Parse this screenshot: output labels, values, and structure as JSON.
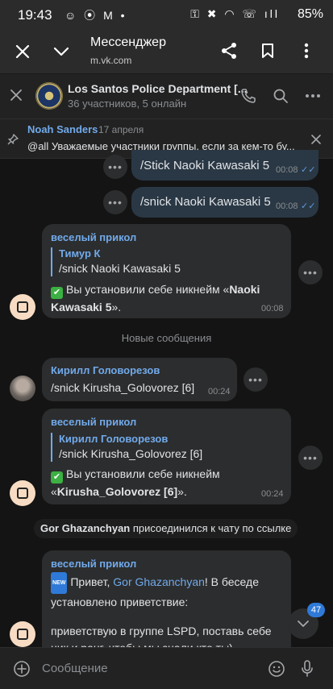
{
  "status_bar": {
    "time": "19:43",
    "left_icons": "☺ ⦿ M •",
    "right_icons": "⚿ ✖ ◠ ☏ ıll",
    "battery": "85%"
  },
  "browser": {
    "title": "Мессенджер",
    "url": "m.vk.com"
  },
  "chat": {
    "name": "Los Santos Police Department [...",
    "subtitle": "36 участников, 5 онлайн"
  },
  "pinned": {
    "author": "Noah Sanders",
    "date": "17 апреля",
    "text": "@all Уважаемые участники группы, если за кем-то бу..."
  },
  "messages": {
    "out1": {
      "text": "/Stick Naoki Kawasaki 5",
      "time": "00:08"
    },
    "out2": {
      "text": "/snick Naoki Kawasaki 5",
      "time": "00:08"
    },
    "bot1": {
      "sender": "веселый прикол",
      "reply_name": "Тимур К",
      "reply_text": "/snick Naoki Kawasaki 5",
      "text_prefix": "Вы установили себе никнейм «",
      "text_bold": "Naoki Kawasaki 5",
      "text_suffix": "».",
      "time": "00:08"
    },
    "new_divider": "Новые сообщения",
    "user1": {
      "sender": "Кирилл Головорезов",
      "text": "/snick Kirusha_Golovorez [6]",
      "time": "00:24"
    },
    "bot2": {
      "sender": "веселый прикол",
      "reply_name": "Кирилл Головорезов",
      "reply_text": "/snick Kirusha_Golovorez [6]",
      "text_prefix": "Вы установили себе никнейм «",
      "text_bold": "Kirusha_Golovorez [6]",
      "text_suffix": "».",
      "time": "00:24"
    },
    "service": {
      "name": "Gor Ghazanchyan",
      "text": " присоединился к чату по ссылке"
    },
    "bot3": {
      "sender": "веселый прикол",
      "badge": "NEW",
      "greet_prefix": "Привет, ",
      "greet_name": "Gor Ghazanchyan",
      "greet_suffix": "! В беседе установлено приветствие:",
      "body": "приветствую в группе LSPD, поставь себе ник и ранг, чтобы мы знали кто ты)"
    }
  },
  "unread_count": "47",
  "composer": {
    "placeholder": "Сообщение"
  },
  "colors": {
    "accent": "#71aaeb",
    "bubble_in": "#2c2d2e",
    "bubble_out": "#2a3845",
    "background": "#141414"
  }
}
